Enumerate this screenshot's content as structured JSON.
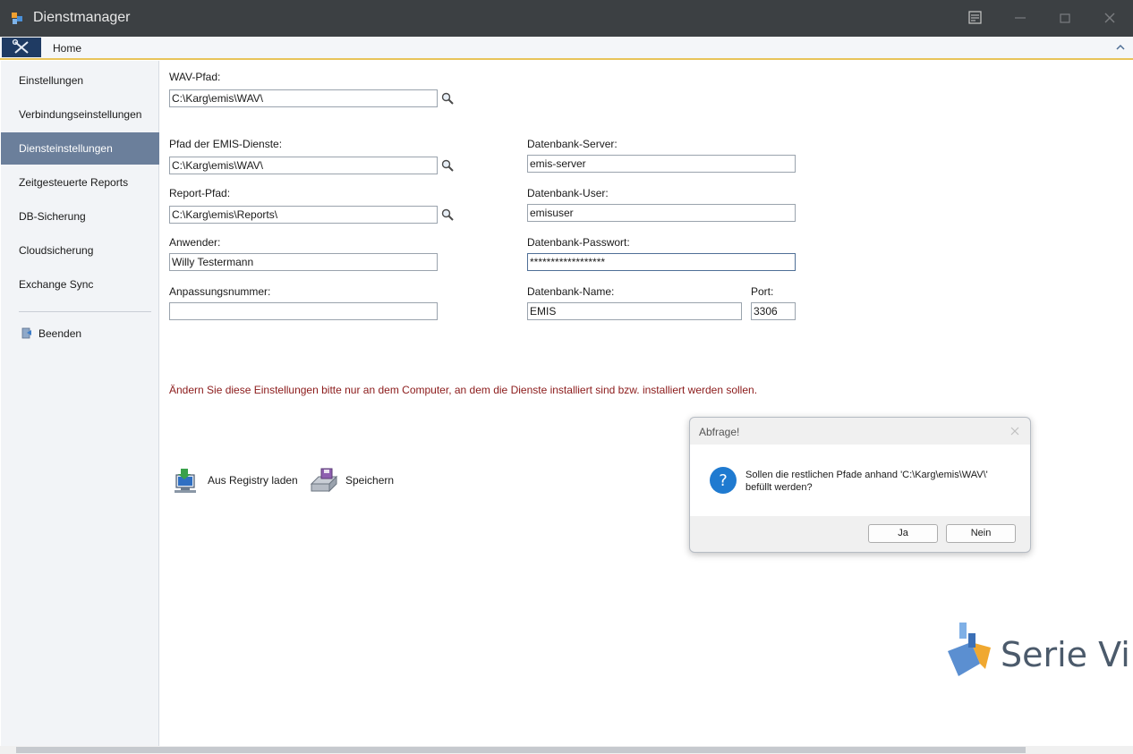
{
  "window": {
    "title": "Dienstmanager"
  },
  "ribbon": {
    "home_tab": "Home"
  },
  "sidebar": {
    "items": [
      {
        "label": "Einstellungen"
      },
      {
        "label": "Verbindungseinstellungen"
      },
      {
        "label": "Diensteinstellungen",
        "active": true
      },
      {
        "label": "Zeitgesteuerte Reports"
      },
      {
        "label": "DB-Sicherung"
      },
      {
        "label": "Cloudsicherung"
      },
      {
        "label": "Exchange Sync"
      }
    ],
    "exit_label": "Beenden"
  },
  "form": {
    "wav_path": {
      "label": "WAV-Pfad:",
      "value": "C:\\Karg\\emis\\WAV\\"
    },
    "services_path": {
      "label": "Pfad der EMIS-Dienste:",
      "value": "C:\\Karg\\emis\\WAV\\"
    },
    "report_path": {
      "label": "Report-Pfad:",
      "value": "C:\\Karg\\emis\\Reports\\"
    },
    "user": {
      "label": "Anwender:",
      "value": "Willy Testermann"
    },
    "custom_number": {
      "label": "Anpassungsnummer:",
      "value": ""
    },
    "db_server": {
      "label": "Datenbank-Server:",
      "value": "emis-server"
    },
    "db_user": {
      "label": "Datenbank-User:",
      "value": "emisuser"
    },
    "db_password": {
      "label": "Datenbank-Passwort:",
      "value": "******************"
    },
    "db_name": {
      "label": "Datenbank-Name:",
      "value": "EMIS"
    },
    "port": {
      "label": "Port:",
      "value": "3306"
    }
  },
  "warning": "Ändern Sie diese Einstellungen bitte nur an dem Computer, an dem die Dienste installiert sind bzw. installiert werden sollen.",
  "actions": {
    "load_registry": "Aus Registry laden",
    "save": "Speichern"
  },
  "dialog": {
    "title": "Abfrage!",
    "message": "Sollen die restlichen Pfade anhand 'C:\\Karg\\emis\\WAV\\' befüllt werden?",
    "yes": "Ja",
    "no": "Nein"
  },
  "logo": {
    "text": "Serie Vi"
  },
  "colors": {
    "titlebar": "#3c4043",
    "active_nav": "#6b7f9b",
    "warning": "#8b1a1a",
    "accent": "#e8c45a"
  }
}
